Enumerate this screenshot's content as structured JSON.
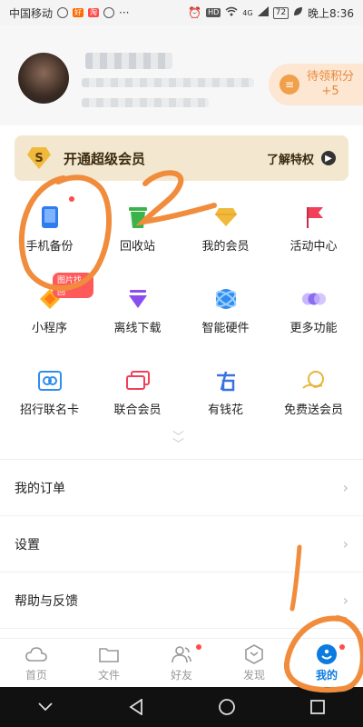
{
  "status_bar": {
    "carrier": "中国移动",
    "badges": [
      "好",
      "淘"
    ],
    "dots": "···",
    "hd": "HD",
    "signal": "4G",
    "battery": "72",
    "time": "晚上8:36"
  },
  "points": {
    "label": "待领积分",
    "value": "+5"
  },
  "vip": {
    "badge": "S",
    "title": "开通超级会员",
    "more": "了解特权"
  },
  "grid": [
    {
      "label": "手机备份",
      "icon": "phone-backup-icon",
      "color": "#2f7bf0",
      "dot": true
    },
    {
      "label": "回收站",
      "icon": "recycle-bin-icon",
      "color": "#3cb34a"
    },
    {
      "label": "我的会员",
      "icon": "diamond-icon",
      "color": "#f1b93c"
    },
    {
      "label": "活动中心",
      "icon": "flag-icon",
      "color": "#f0405a"
    },
    {
      "label": "小程序",
      "icon": "mini-program-icon",
      "color": "#ffb020",
      "tag": "图片找回"
    },
    {
      "label": "离线下载",
      "icon": "offline-download-icon",
      "color": "#8a4df0"
    },
    {
      "label": "智能硬件",
      "icon": "smart-hardware-icon",
      "color": "#2f8df0"
    },
    {
      "label": "更多功能",
      "icon": "more-features-icon",
      "color": "#8a6df0"
    },
    {
      "label": "招行联名卡",
      "icon": "bank-card-icon",
      "color": "#2f8df0"
    },
    {
      "label": "联合会员",
      "icon": "joint-member-icon",
      "color": "#f0405a"
    },
    {
      "label": "有钱花",
      "icon": "loan-icon",
      "color": "#3a73e0"
    },
    {
      "label": "免费送会员",
      "icon": "free-vip-icon",
      "color": "#e8b53a"
    }
  ],
  "menu": [
    {
      "label": "我的订单"
    },
    {
      "label": "设置"
    },
    {
      "label": "帮助与反馈"
    }
  ],
  "tabs": [
    {
      "label": "首页",
      "icon": "home-cloud-icon"
    },
    {
      "label": "文件",
      "icon": "folder-icon"
    },
    {
      "label": "好友",
      "icon": "friends-icon",
      "dot": true
    },
    {
      "label": "发现",
      "icon": "discover-icon"
    },
    {
      "label": "我的",
      "icon": "profile-icon",
      "active": true,
      "dot": true
    }
  ],
  "annotations": {
    "step_one": "1",
    "step_two": "2",
    "color": "#f08c3c"
  },
  "colors": {
    "accent": "#0a7be0",
    "vip_bg": "#f3e8cf",
    "points_text": "#e8893a"
  }
}
